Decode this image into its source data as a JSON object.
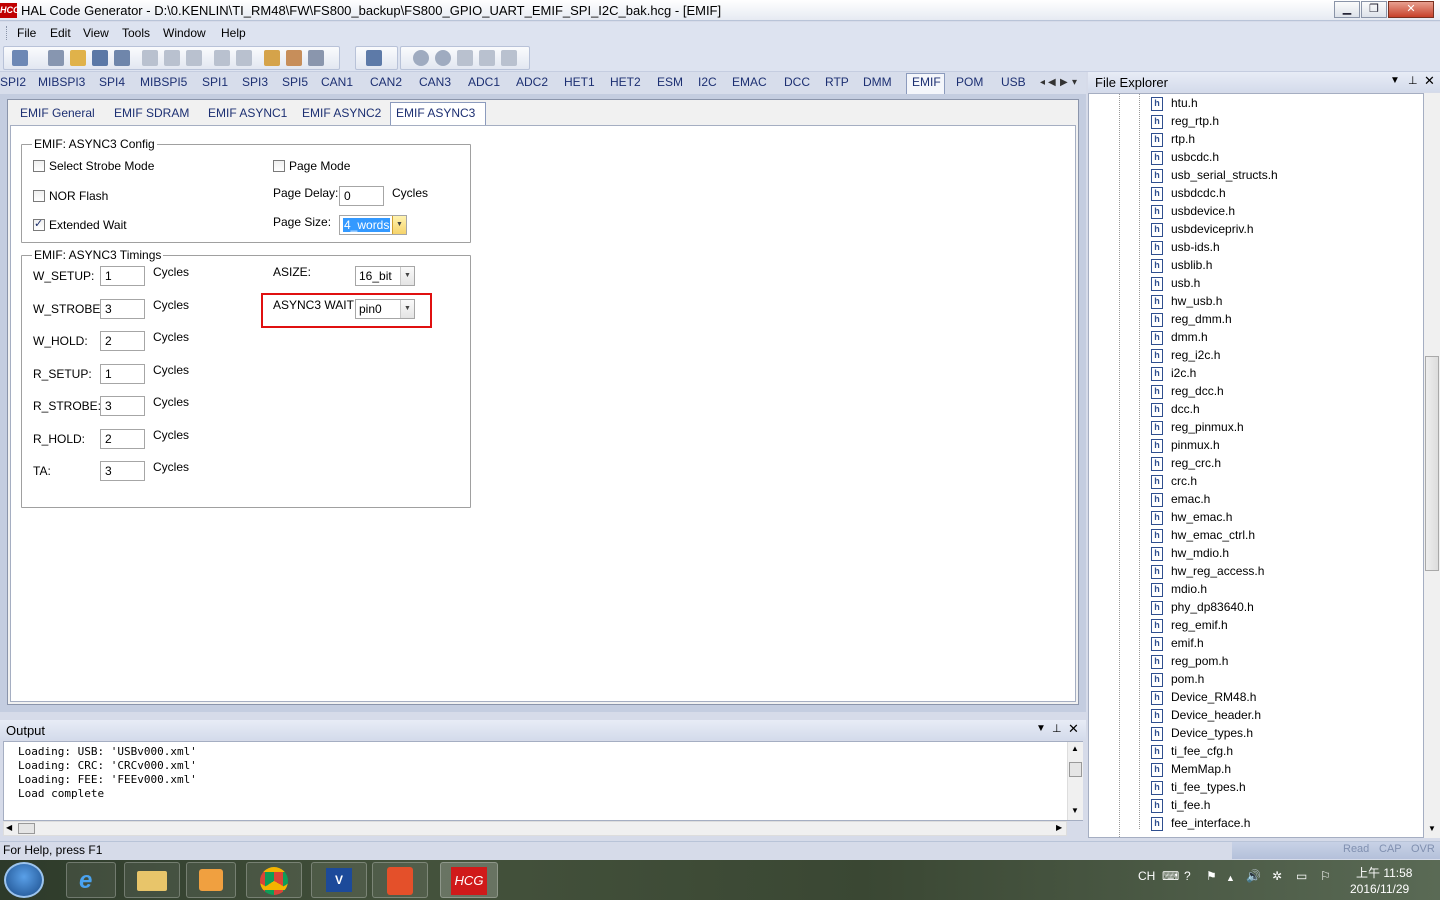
{
  "window": {
    "app_icon_text": "HCG",
    "title": "HAL Code Generator - D:\\0.KENLIN\\TI_RM48\\FW\\FS800_backup\\FS800_GPIO_UART_EMIF_SPI_I2C_bak.hcg - [EMIF]"
  },
  "menu": [
    "File",
    "Edit",
    "View",
    "Tools",
    "Window",
    "Help"
  ],
  "module_tabs": [
    "SPI2",
    "MIBSPI3",
    "SPI4",
    "MIBSPI5",
    "SPI1",
    "SPI3",
    "SPI5",
    "CAN1",
    "CAN2",
    "CAN3",
    "ADC1",
    "ADC2",
    "HET1",
    "HET2",
    "ESM",
    "I2C",
    "EMAC",
    "DCC",
    "RTP",
    "DMM",
    "EMIF",
    "POM",
    "USB"
  ],
  "module_active": "EMIF",
  "sub_tabs": [
    "EMIF General",
    "EMIF SDRAM",
    "EMIF ASYNC1",
    "EMIF ASYNC2",
    "EMIF ASYNC3"
  ],
  "config": {
    "legend": "EMIF: ASYNC3 Config",
    "select_strobe_label": "Select Strobe Mode",
    "nor_flash_label": "NOR Flash",
    "extended_wait_label": "Extended Wait",
    "page_mode_label": "Page Mode",
    "page_delay_label": "Page Delay:",
    "page_delay_value": "0",
    "page_delay_unit": "Cycles",
    "page_size_label": "Page Size:",
    "page_size_value": "4_words",
    "select_strobe_checked": false,
    "nor_flash_checked": false,
    "extended_wait_checked": true,
    "page_mode_checked": false
  },
  "timings": {
    "legend": "EMIF: ASYNC3 Timings",
    "rows": [
      {
        "label": "W_SETUP:",
        "value": "1",
        "unit": "Cycles"
      },
      {
        "label": "W_STROBE:",
        "value": "3",
        "unit": "Cycles"
      },
      {
        "label": "W_HOLD:",
        "value": "2",
        "unit": "Cycles"
      },
      {
        "label": "R_SETUP:",
        "value": "1",
        "unit": "Cycles"
      },
      {
        "label": "R_STROBE:",
        "value": "3",
        "unit": "Cycles"
      },
      {
        "label": "R_HOLD:",
        "value": "2",
        "unit": "Cycles"
      },
      {
        "label": "TA:",
        "value": "3",
        "unit": "Cycles"
      }
    ],
    "asize_label": "ASIZE:",
    "asize_value": "16_bit",
    "wait_label": "ASYNC3 WAIT",
    "wait_value": "pin0"
  },
  "output": {
    "title": "Output",
    "lines": [
      "Loading: USB: 'USBv000.xml'",
      "Loading: CRC: 'CRCv000.xml'",
      "Loading: FEE: 'FEEv000.xml'",
      "Load complete"
    ]
  },
  "file_explorer": {
    "title": "File Explorer",
    "files": [
      "htu.h",
      "reg_rtp.h",
      "rtp.h",
      "usbcdc.h",
      "usb_serial_structs.h",
      "usbdcdc.h",
      "usbdevice.h",
      "usbdevicepriv.h",
      "usb-ids.h",
      "usblib.h",
      "usb.h",
      "hw_usb.h",
      "reg_dmm.h",
      "dmm.h",
      "reg_i2c.h",
      "i2c.h",
      "reg_dcc.h",
      "dcc.h",
      "reg_pinmux.h",
      "pinmux.h",
      "reg_crc.h",
      "crc.h",
      "emac.h",
      "hw_emac.h",
      "hw_emac_ctrl.h",
      "hw_mdio.h",
      "hw_reg_access.h",
      "mdio.h",
      "phy_dp83640.h",
      "reg_emif.h",
      "emif.h",
      "reg_pom.h",
      "pom.h",
      "Device_RM48.h",
      "Device_header.h",
      "Device_types.h",
      "ti_fee_cfg.h",
      "MemMap.h",
      "ti_fee_types.h",
      "ti_fee.h",
      "fee_interface.h"
    ]
  },
  "status": {
    "help_text": "For Help, press F1",
    "indicators": [
      "Read",
      "CAP",
      "OVR"
    ]
  },
  "taskbar": {
    "hcg_label": "HCG",
    "lang": "CH",
    "time": "上午 11:58",
    "date": "2016/11/29"
  },
  "colors": {
    "highlight_box": "#e01010",
    "selection": "#3399ff",
    "tab_text": "#1c2f72"
  }
}
